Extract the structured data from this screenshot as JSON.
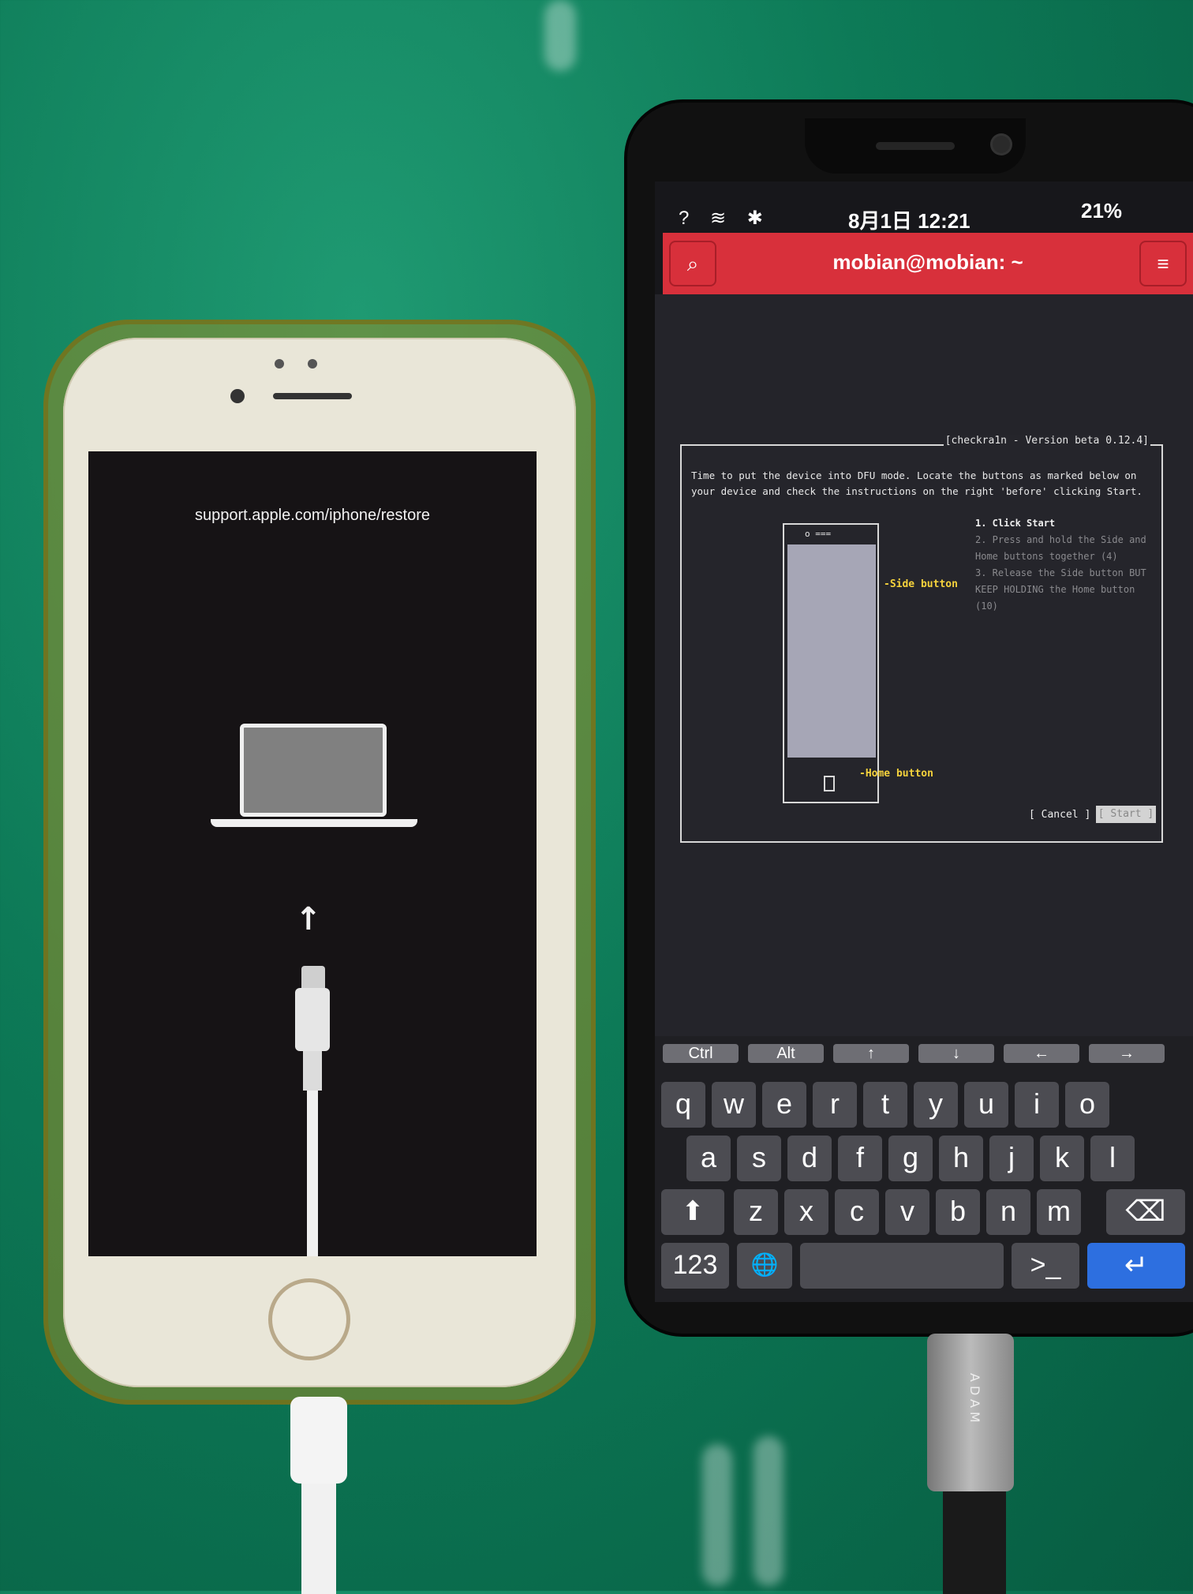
{
  "iphone": {
    "restore_url": "support.apple.com/iphone/restore",
    "arrow": "↑"
  },
  "pinephone": {
    "status": {
      "icons": "? ≋ ✱",
      "time": "8月1日 12:21",
      "battery": "21%"
    },
    "titlebar": {
      "title": "mobian@mobian: ~",
      "search_icon": "⌕",
      "menu_icon": "≡"
    },
    "dialog": {
      "title": "[checkra1n - Version beta 0.12.4]",
      "intro": "Time to put the device into DFU mode. Locate the buttons as marked below on your device and check the instructions on the right 'before' clicking Start.",
      "device_top": "o ===",
      "side_button_label": "-Side button",
      "home_button_label": "-Home button",
      "steps": [
        "1. Click Start",
        "2. Press and hold the Side and Home buttons together (4)",
        "3. Release the Side button BUT KEEP HOLDING the Home button (10)"
      ],
      "cancel": "[ Cancel ]",
      "start": "[ Start ]"
    },
    "keyboard": {
      "modifiers": [
        "Ctrl",
        "Alt",
        "↑",
        "↓",
        "←",
        "→"
      ],
      "row1": [
        "q",
        "w",
        "e",
        "r",
        "t",
        "y",
        "u",
        "i",
        "o"
      ],
      "row2": [
        "a",
        "s",
        "d",
        "f",
        "g",
        "h",
        "j",
        "k",
        "l"
      ],
      "row3": [
        "z",
        "x",
        "c",
        "v",
        "b",
        "n",
        "m"
      ],
      "shift": "⬆",
      "numbers": "123",
      "globe": "🌐",
      "terminal": ">_",
      "backspace": "⌫",
      "enter": "↵",
      "chevron": "^"
    }
  },
  "cable_brand": "ADAM"
}
